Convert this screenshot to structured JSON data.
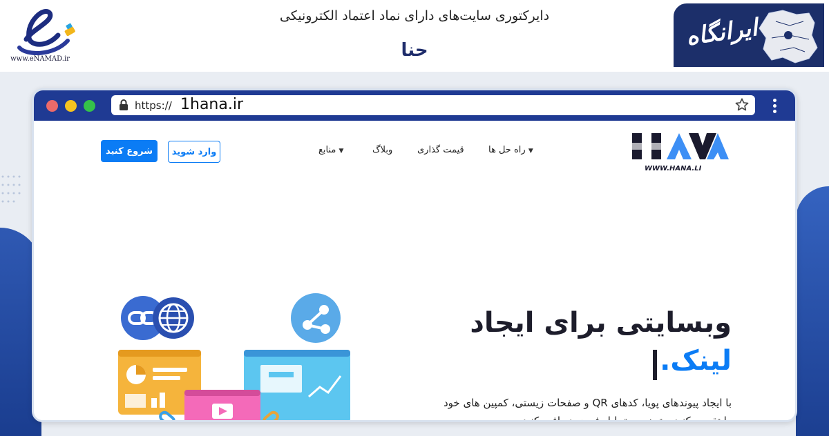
{
  "banner": {
    "enamad_url": "www.eNAMAD.ir",
    "title": "دایرکتوری سایت‌های دارای نماد اعتماد الکترونیکی",
    "site_name": "حنا",
    "brand_logo_text": "ایرانگاه"
  },
  "browser": {
    "url_prefix": "https://",
    "url_domain": "1hana.ir"
  },
  "site": {
    "header": {
      "start_button": "شروع کنید",
      "login_button": "وارد شوید",
      "nav": {
        "solutions": "راه حل ها",
        "pricing": "قیمت گذاری",
        "blog": "وبلاگ",
        "resources": "منابع"
      },
      "logo_text": "WWW.HANA.LI"
    },
    "hero": {
      "title": "وبسایتی برای ایجاد",
      "highlight": "لینک.",
      "description": "با ایجاد پیوندهای پویا، کدهای QR و صفحات زیستی، کمپین های خود را تقویت کنید و تجزیه و تحلیل فوری دریافت کنید"
    }
  },
  "colors": {
    "navy": "#1f3a93",
    "accent_blue": "#0b7cf5",
    "dark_text": "#1d1d2b"
  }
}
